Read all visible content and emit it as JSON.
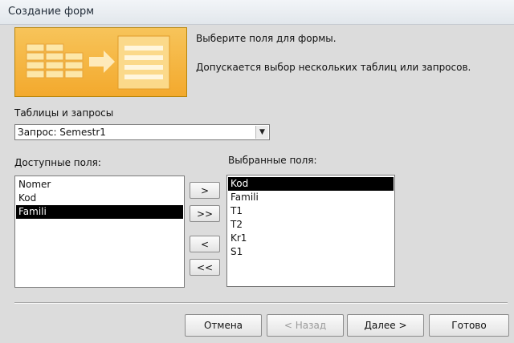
{
  "window": {
    "title": "Создание форм"
  },
  "intro": {
    "heading": "Выберите поля для формы.",
    "note": "Допускается выбор нескольких таблиц или запросов."
  },
  "source": {
    "label": "Таблицы и запросы",
    "selected": "Запрос: Semestr1"
  },
  "available": {
    "label": "Доступные поля:",
    "items": [
      "Nomer",
      "Kod",
      "Famili"
    ],
    "selected_index": 2
  },
  "selected_fields": {
    "label": "Выбранные поля:",
    "items": [
      "Kod",
      "Famili",
      "T1",
      "T2",
      "Kr1",
      "S1"
    ],
    "selected_index": 0
  },
  "move_buttons": {
    "add_one": ">",
    "add_all": ">>",
    "remove_one": "<",
    "remove_all": "<<"
  },
  "footer": {
    "cancel": "Отмена",
    "back": "< Назад",
    "next": "Далее >",
    "finish": "Готово"
  }
}
